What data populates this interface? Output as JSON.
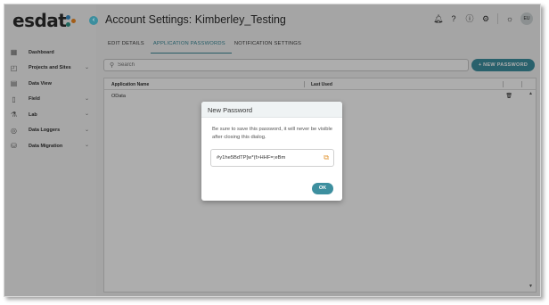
{
  "app": {
    "logo": "esdat",
    "page_title": "Account Settings: Kimberley_Testing",
    "avatar": "EU"
  },
  "header_icons": [
    "bell-icon",
    "help-icon",
    "info-icon",
    "settings-icon",
    "brightness-icon"
  ],
  "sidebar": {
    "items": [
      {
        "label": "Dashboard",
        "icon": "dashboard-icon",
        "chevron": false
      },
      {
        "label": "Projects and Sites",
        "icon": "projects-icon",
        "chevron": true
      },
      {
        "label": "Data View",
        "icon": "data-view-icon",
        "chevron": false
      },
      {
        "label": "Field",
        "icon": "field-icon",
        "chevron": true
      },
      {
        "label": "Lab",
        "icon": "lab-icon",
        "chevron": true
      },
      {
        "label": "Data Loggers",
        "icon": "data-loggers-icon",
        "chevron": true
      },
      {
        "label": "Data Migration",
        "icon": "data-migration-icon",
        "chevron": true
      }
    ]
  },
  "tabs": [
    {
      "label": "EDIT DETAILS",
      "active": false
    },
    {
      "label": "APPLICATION PASSWORDS",
      "active": true
    },
    {
      "label": "NOTIFICATION SETTINGS",
      "active": false
    }
  ],
  "search": {
    "placeholder": "Search"
  },
  "new_password_button": "+ NEW PASSWORD",
  "table": {
    "columns": [
      "Application Name",
      "Last Used"
    ],
    "rows": [
      {
        "name": "OData",
        "last_used": ""
      }
    ]
  },
  "dialog": {
    "title": "New Password",
    "message": "Be sure to save this password, it will never be visible after closing this dialog.",
    "password": "#y1he5BdTP[w*(f>HHF=;eBm",
    "ok_label": "OK"
  },
  "colors": {
    "accent": "#3d8f9f",
    "copy_icon": "#e39a3b",
    "logo_dot_blue": "#3a8fc8",
    "logo_dot_orange": "#f08a24",
    "logo_dot_teal": "#2f9a8a"
  }
}
